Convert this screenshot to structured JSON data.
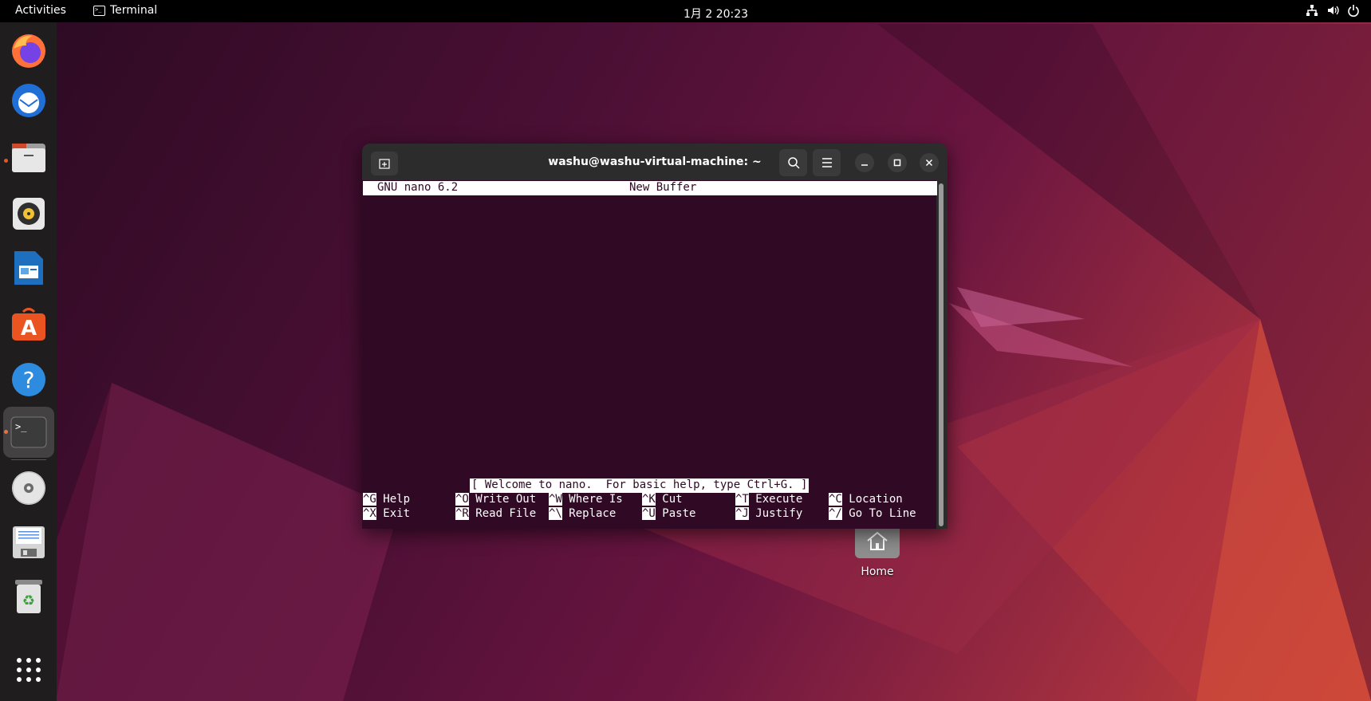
{
  "topbar": {
    "activities": "Activities",
    "app_name": "Terminal",
    "clock": "1月 2  20:23",
    "tray_icons": [
      "network-icon",
      "volume-icon",
      "power-icon"
    ]
  },
  "dock": {
    "items": [
      {
        "name": "firefox-icon",
        "running": false
      },
      {
        "name": "thunderbird-icon",
        "running": false
      },
      {
        "name": "files-icon",
        "running": true
      },
      {
        "name": "rhythmbox-icon",
        "running": false
      },
      {
        "name": "libreoffice-writer-icon",
        "running": false
      },
      {
        "name": "software-center-icon",
        "running": false
      },
      {
        "name": "help-icon",
        "running": false
      },
      {
        "name": "terminal-icon",
        "running": true
      },
      {
        "name": "dvd-drive-icon",
        "running": false
      },
      {
        "name": "floppy-drive-icon",
        "running": false
      },
      {
        "name": "trash-icon",
        "running": false
      },
      {
        "name": "show-apps-icon",
        "running": false
      }
    ]
  },
  "terminal": {
    "title": "washu@washu-virtual-machine: ~",
    "nano": {
      "version": "GNU nano 6.2",
      "buffer": "New Buffer",
      "status": "[ Welcome to nano.  For basic help, type Ctrl+G. ]",
      "shortcuts_row1": [
        {
          "key": "^G",
          "label": " Help"
        },
        {
          "key": "^O",
          "label": " Write Out"
        },
        {
          "key": "^W",
          "label": " Where Is"
        },
        {
          "key": "^K",
          "label": " Cut"
        },
        {
          "key": "^T",
          "label": " Execute"
        },
        {
          "key": "^C",
          "label": " Location"
        }
      ],
      "shortcuts_row2": [
        {
          "key": "^X",
          "label": " Exit"
        },
        {
          "key": "^R",
          "label": " Read File"
        },
        {
          "key": "^\\",
          "label": " Replace"
        },
        {
          "key": "^U",
          "label": " Paste"
        },
        {
          "key": "^J",
          "label": " Justify"
        },
        {
          "key": "^/",
          "label": " Go To Line"
        }
      ]
    }
  },
  "desktop": {
    "home_label": "Home"
  },
  "colors": {
    "terminal_bg": "#300a24",
    "dock_bg": "#1f1d1e",
    "accent": "#e95420"
  }
}
